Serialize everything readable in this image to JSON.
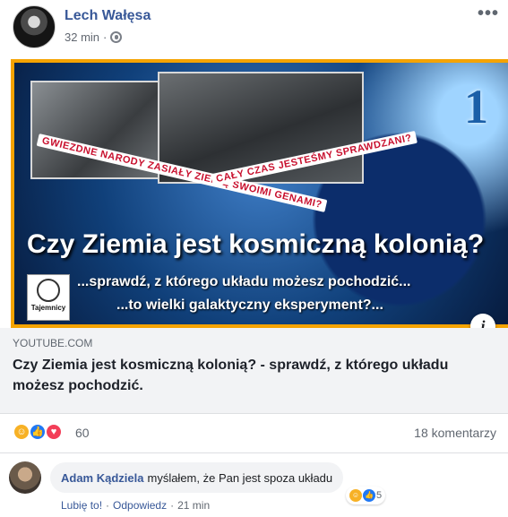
{
  "post": {
    "author": "Lech Wałęsa",
    "time": "32 min",
    "separator": "·",
    "more_label": "•••"
  },
  "banner": {
    "number": "1",
    "stamp_a": "GWIEZDNE NARODY ZASIAŁY ZIEMIĘ SWOIMI GENAMI?",
    "stamp_b": "CAŁY CZAS JESTEŚMY SPRAWDZANI?",
    "headline": "Czy Ziemia jest kosmiczną kolonią?",
    "sub1": "...sprawdź, z którego układu możesz pochodzić...",
    "sub2": "...to wielki galaktyczny eksperyment?...",
    "logo_name": "Tajemnicy",
    "info_label": "i"
  },
  "link": {
    "domain": "YOUTUBE.COM",
    "title": "Czy Ziemia jest kosmiczną kolonią? - sprawdź, z którego układu możesz pochodzić."
  },
  "stats": {
    "reactions_count": "60",
    "comments_count": "18 komentarzy",
    "reaction_icons": [
      "haha-icon",
      "like-icon",
      "love-icon"
    ]
  },
  "comment": {
    "author": "Adam Kądziela",
    "text": "myślałem, że Pan jest spoza układu",
    "reactions_count": "5",
    "like_label": "Lubię to!",
    "reply_label": "Odpowiedz",
    "time": "21 min",
    "separator": "·"
  },
  "colors": {
    "link_blue": "#385898",
    "banner_border": "#f5a300",
    "like_blue": "#2078f4",
    "love_red": "#f33e58",
    "haha_yellow": "#f7b125"
  }
}
